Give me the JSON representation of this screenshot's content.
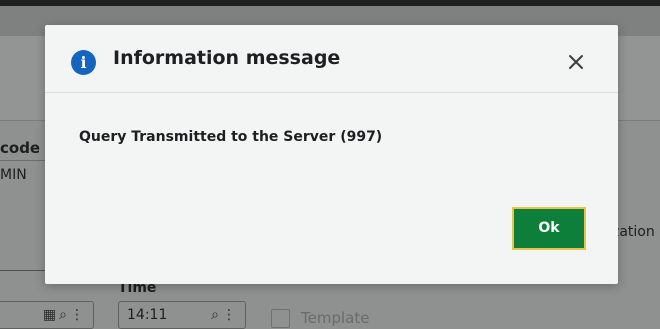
{
  "background": {
    "field_code_label": "code",
    "required_marker": "*",
    "field_code_value": "MIN",
    "time_label": "Time",
    "time_value": "14:11",
    "template_label": "Template",
    "partial_right_text": "zation"
  },
  "dialog": {
    "title": "Information message",
    "message": "Query Transmitted to the Server (997)",
    "ok_label": "Ok",
    "info_glyph": "i",
    "icons": [
      "info-icon",
      "close-icon"
    ],
    "colors": {
      "ok_button": "#0d7f3a",
      "ok_border": "#e8c44a",
      "info_icon": "#1565c0"
    }
  }
}
